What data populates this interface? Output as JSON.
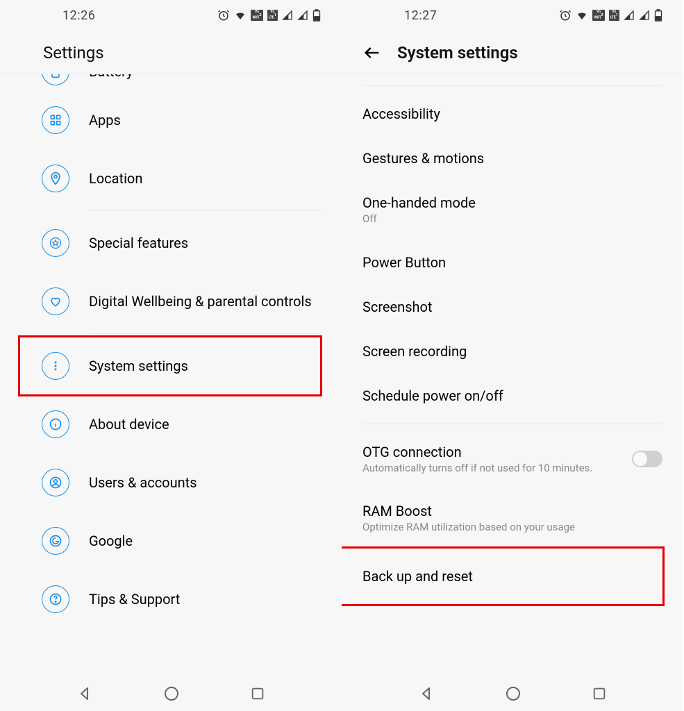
{
  "left": {
    "status": {
      "time": "12:26"
    },
    "header": {
      "title": "Settings"
    },
    "items": {
      "battery": {
        "label": "Battery"
      },
      "apps": {
        "label": "Apps"
      },
      "location": {
        "label": "Location"
      },
      "special": {
        "label": "Special features"
      },
      "wellbeing": {
        "label": "Digital Wellbeing & parental controls"
      },
      "system": {
        "label": "System settings"
      },
      "about": {
        "label": "About device"
      },
      "users": {
        "label": "Users & accounts"
      },
      "google": {
        "label": "Google"
      },
      "tips": {
        "label": "Tips & Support"
      }
    }
  },
  "right": {
    "status": {
      "time": "12:27"
    },
    "header": {
      "title": "System settings"
    },
    "items": {
      "accessibility": {
        "label": "Accessibility"
      },
      "gestures": {
        "label": "Gestures & motions"
      },
      "onehanded": {
        "label": "One-handed mode",
        "sub": "Off"
      },
      "power": {
        "label": "Power Button"
      },
      "screenshot": {
        "label": "Screenshot"
      },
      "recording": {
        "label": "Screen recording"
      },
      "schedule": {
        "label": "Schedule power on/off"
      },
      "otg": {
        "label": "OTG connection",
        "sub": "Automatically turns off if not used for 10 minutes."
      },
      "ram": {
        "label": "RAM Boost",
        "sub": "Optimize RAM utilization based on your usage"
      },
      "backup": {
        "label": "Back up and reset"
      }
    }
  },
  "badges": {
    "vowifi": "WiFi",
    "volte": "LTE",
    "vo": "Vo",
    "sup": "2",
    "sup1": "1"
  }
}
